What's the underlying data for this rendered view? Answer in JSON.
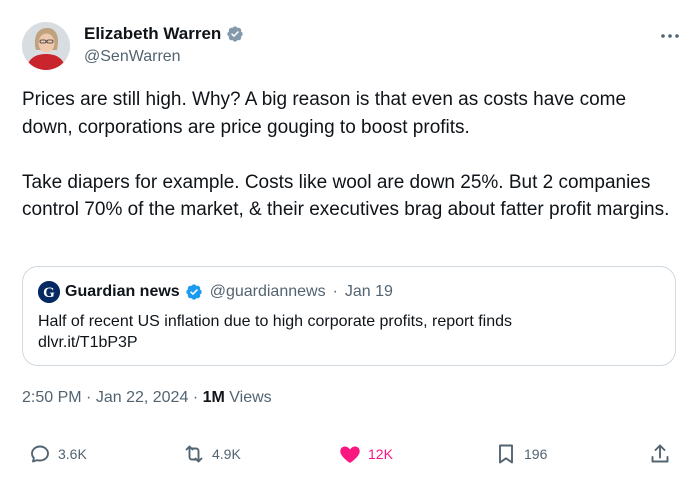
{
  "author": {
    "name": "Elizabeth Warren",
    "handle": "@SenWarren",
    "avatar_icon": "profile-photo",
    "verified_color": "#829aab"
  },
  "tweet": {
    "paragraphs": [
      "Prices are still high. Why? A big reason is that even as costs have come down, corporations are price gouging to boost profits.",
      "Take diapers for example. Costs like wool are down 25%. But 2 companies control 70% of the market, & their executives brag about fatter profit margins."
    ]
  },
  "quote": {
    "name": "Guardian news",
    "handle": "@guardiannews",
    "separator": "·",
    "date": "Jan 19",
    "text": "Half of recent US inflation due to high corporate profits, report finds",
    "link": "dlvr.it/T1bP3P",
    "verified_color": "#1d9bf0",
    "logo_icon": "guardian-g-logo"
  },
  "meta": {
    "time": "2:50 PM",
    "date": "Jan 22, 2024",
    "views_count": "1M",
    "views_label": "Views"
  },
  "actions": {
    "replies": "3.6K",
    "reposts": "4.9K",
    "likes": "12K",
    "bookmarks": "196",
    "like_color": "#f91880"
  }
}
